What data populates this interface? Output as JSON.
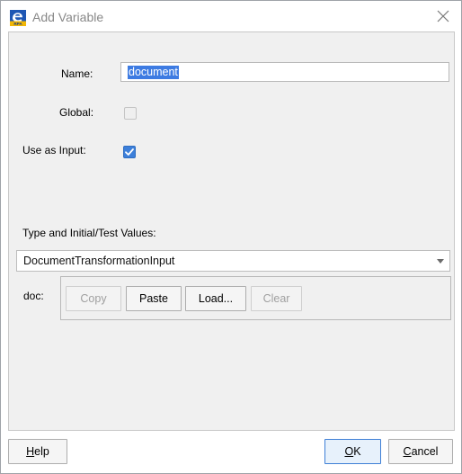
{
  "window": {
    "title": "Add Variable",
    "close_icon": "close-icon",
    "app_icon": "app-logo-icon",
    "app_icon_caption": "RPA"
  },
  "form": {
    "name_label": "Name:",
    "name_value": "document",
    "global_label": "Global:",
    "global_checked": false,
    "use_as_input_label": "Use as Input:",
    "use_as_input_checked": true,
    "type_section_label": "Type and Initial/Test Values:",
    "type_selected": "DocumentTransformationInput",
    "doc_label": "doc:"
  },
  "doc_buttons": {
    "copy": "Copy",
    "paste": "Paste",
    "load": "Load...",
    "clear": "Clear"
  },
  "footer": {
    "help_mnemonic": "H",
    "help_rest": "elp",
    "ok_mnemonic": "O",
    "ok_rest": "K",
    "cancel_mnemonic": "C",
    "cancel_rest": "ancel"
  },
  "colors": {
    "accent": "#3c7fda",
    "selection": "#3d7be2",
    "panel_bg": "#f0f0f0"
  }
}
